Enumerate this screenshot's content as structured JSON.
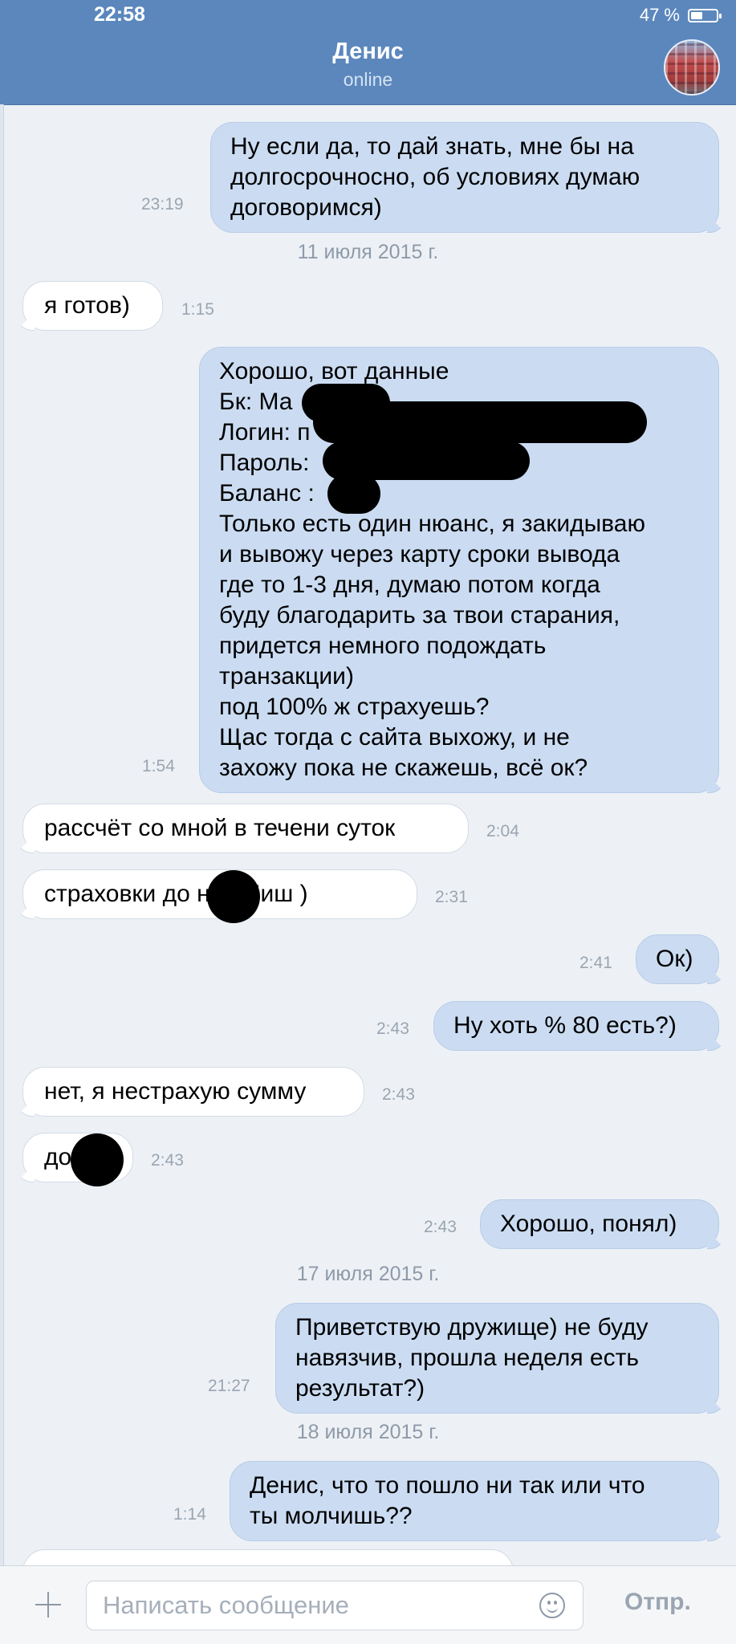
{
  "status_bar": {
    "time": "22:58",
    "battery": "47 %",
    "battery_level": 0.47
  },
  "header": {
    "name": "Денис",
    "status": "online"
  },
  "messages": [
    {
      "dir": "out",
      "text": "Ну если да, то дай знать, мне бы на\nдолгосрочносно, об условиях думаю\nдоговоримся)",
      "time": "23:19"
    },
    {
      "dir": "date",
      "text": "11 июля 2015 г."
    },
    {
      "dir": "in",
      "text": "я готов)",
      "time": "1:15"
    },
    {
      "dir": "out",
      "text": "Хорошо, вот данные\nБк: Ма\nЛогин: п\nПароль:\nБаланс :\nТолько есть один нюанс, я закидываю\nи вывожу через карту сроки вывода\nгде то 1-3 дня, думаю потом когда\nбуду благодарить за твои старания,\nпридется немного подождать\nтранзакции)\nпод 100%  ж страхуешь?\nЩас тогда с сайта выхожу, и не\nзахожу пока не скажешь, всё ок?",
      "time": "1:54"
    },
    {
      "dir": "in",
      "text": "рассчёт со мной в течени суток",
      "time": "2:04"
    },
    {
      "dir": "in",
      "text": "страховки до   нет Миш )",
      "time": "2:31"
    },
    {
      "dir": "out",
      "text": "Ок)",
      "time": "2:41"
    },
    {
      "dir": "out",
      "text": "Ну хоть % 80 есть?)",
      "time": "2:43"
    },
    {
      "dir": "in",
      "text": "нет, я нестрахую сумму",
      "time": "2:43"
    },
    {
      "dir": "in",
      "text": "до",
      "time": "2:43"
    },
    {
      "dir": "out",
      "text": "Хорошо, понял)",
      "time": "2:43"
    },
    {
      "dir": "date",
      "text": "17 июля 2015 г."
    },
    {
      "dir": "out",
      "text": "Приветствую дружище) не буду\nнавязчив, прошла неделя есть\nрезультат?)",
      "time": "21:27"
    },
    {
      "dir": "date",
      "text": "18 июля 2015 г."
    },
    {
      "dir": "out",
      "text": "Денис, что то пошло ни так или что\nты молчишь??",
      "time": "1:14"
    }
  ],
  "composer": {
    "placeholder": "Написать сообщение",
    "send_label": "Отпр."
  },
  "colors": {
    "header_bg": "#5b87bd",
    "chat_bg": "#edf1f6",
    "out_bubble": "#cbdcf2",
    "in_bubble": "#ffffff"
  },
  "icons": {
    "add": "plus-icon",
    "emoji": "smile-icon",
    "avatar": "avatar"
  }
}
